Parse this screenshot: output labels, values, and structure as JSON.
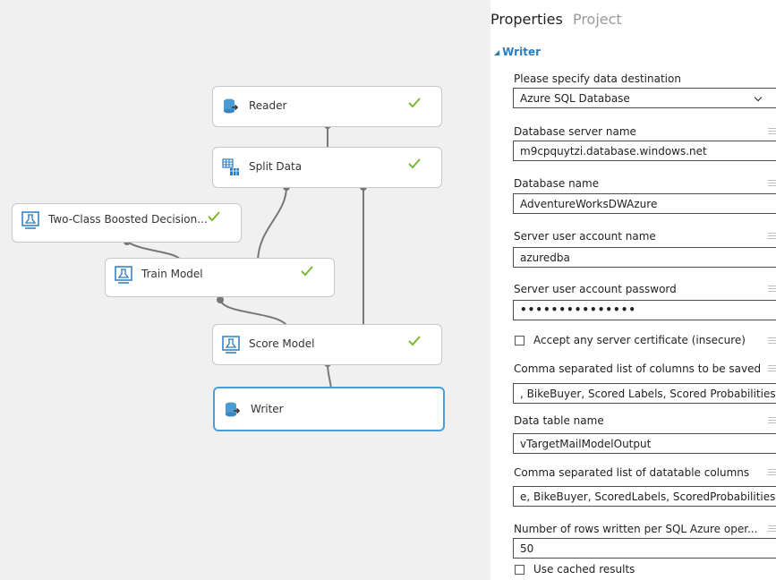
{
  "canvas": {
    "modules": [
      {
        "id": "reader",
        "label": "Reader",
        "icon": "database-reader-icon",
        "status": "completed"
      },
      {
        "id": "split-data",
        "label": "Split Data",
        "icon": "split-data-icon",
        "status": "completed"
      },
      {
        "id": "two-class-boosted",
        "label": "Two-Class Boosted Decision...",
        "icon": "model-icon",
        "status": "completed"
      },
      {
        "id": "train-model",
        "label": "Train Model",
        "icon": "model-icon",
        "status": "completed"
      },
      {
        "id": "score-model",
        "label": "Score Model",
        "icon": "model-icon",
        "status": "completed"
      },
      {
        "id": "writer",
        "label": "Writer",
        "icon": "database-writer-icon",
        "status": "selected"
      }
    ]
  },
  "properties": {
    "tabs": [
      "Properties",
      "Project"
    ],
    "section": "Writer",
    "fields": {
      "destination_label": "Please specify data destination",
      "destination_value": "Azure SQL Database",
      "server_label": "Database server name",
      "server_value": "m9cpquytzi.database.windows.net",
      "dbname_label": "Database name",
      "dbname_value": "AdventureWorksDWAzure",
      "user_label": "Server user account name",
      "user_value": "azuredba",
      "password_label": "Server user account password",
      "password_value": "•••••••••••••••",
      "accept_cert_label": "Accept any server certificate (insecure)",
      "columns_label": "Comma separated list of columns to be saved",
      "columns_value": ", BikeBuyer, Scored Labels, Scored Probabilities",
      "table_label": "Data table name",
      "table_value": "vTargetMailModelOutput",
      "datatable_cols_label": "Comma separated list of datatable columns",
      "datatable_cols_value": "e, BikeBuyer, ScoredLabels, ScoredProbabilities",
      "rows_label": "Number of rows written per SQL Azure oper...",
      "rows_value": "50",
      "cached_label": "Use cached results"
    }
  },
  "colors": {
    "canvas_bg": "#f0f0f0",
    "accent": "#2b7cbf",
    "check": "#7cb82f",
    "selected_border": "#4a9fd9"
  }
}
